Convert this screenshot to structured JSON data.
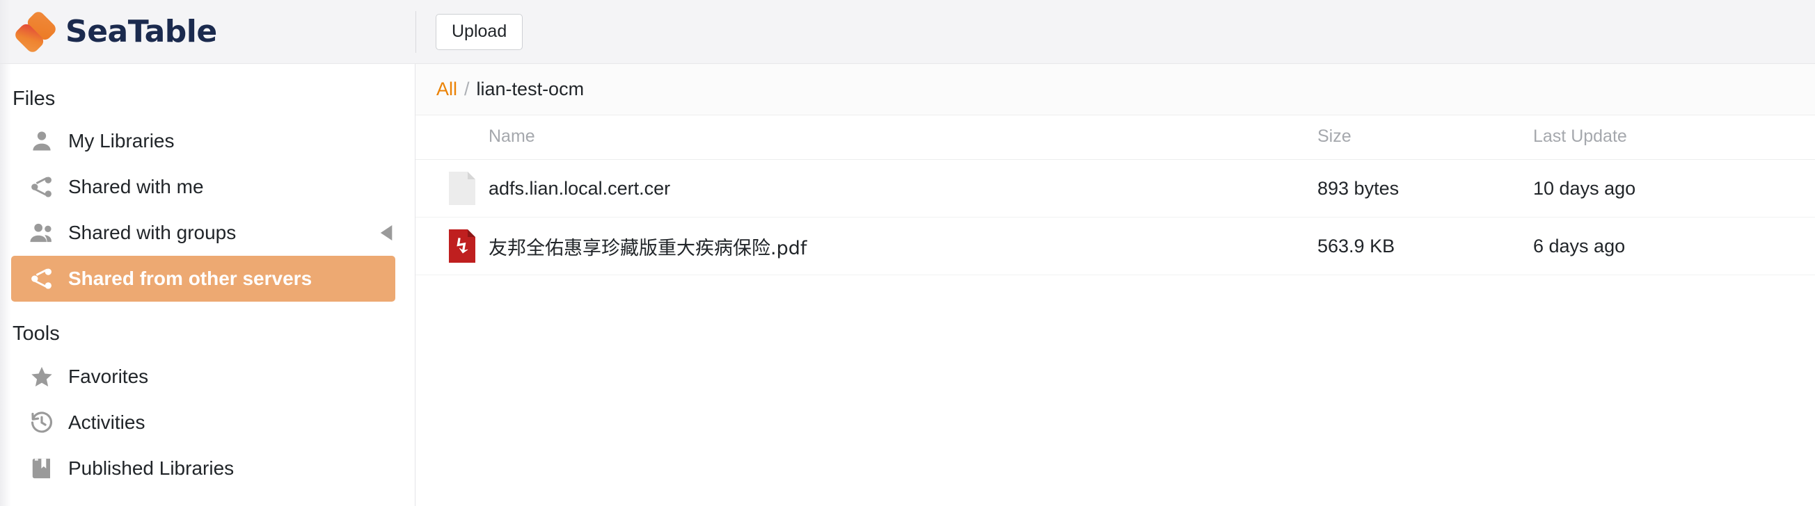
{
  "app": {
    "brand_name": "SeaTable",
    "brand_navy": "#1b2a4e",
    "brand_orange": "#ed7d31",
    "accent_orange": "#eb8205",
    "active_item_bg": "#eda972"
  },
  "toolbar": {
    "upload_label": "Upload"
  },
  "sidebar": {
    "sections": [
      {
        "heading": "Files",
        "items": [
          {
            "label": "My Libraries",
            "icon": "user-icon",
            "active": false,
            "has_toggle": false
          },
          {
            "label": "Shared with me",
            "icon": "share-nodes-icon",
            "active": false,
            "has_toggle": false
          },
          {
            "label": "Shared with groups",
            "icon": "users-group-icon",
            "active": false,
            "has_toggle": true
          },
          {
            "label": "Shared from other servers",
            "icon": "share-nodes-icon",
            "active": true,
            "has_toggle": false
          }
        ]
      },
      {
        "heading": "Tools",
        "items": [
          {
            "label": "Favorites",
            "icon": "star-icon",
            "active": false,
            "has_toggle": false
          },
          {
            "label": "Activities",
            "icon": "clock-history-icon",
            "active": false,
            "has_toggle": false
          },
          {
            "label": "Published Libraries",
            "icon": "book-icon",
            "active": false,
            "has_toggle": false
          }
        ]
      }
    ]
  },
  "breadcrumb": {
    "root_label": "All",
    "separator": "/",
    "current_label": "lian-test-ocm"
  },
  "file_table": {
    "columns": {
      "icon": "",
      "name": "Name",
      "size": "Size",
      "last_update": "Last Update"
    },
    "rows": [
      {
        "icon": "file-blank-icon",
        "name": "adfs.lian.local.cert.cer",
        "size": "893 bytes",
        "last_update": "10 days ago"
      },
      {
        "icon": "file-pdf-icon",
        "name": "友邦全佑惠享珍藏版重大疾病保险.pdf",
        "size": "563.9 KB",
        "last_update": "6 days ago"
      }
    ]
  }
}
